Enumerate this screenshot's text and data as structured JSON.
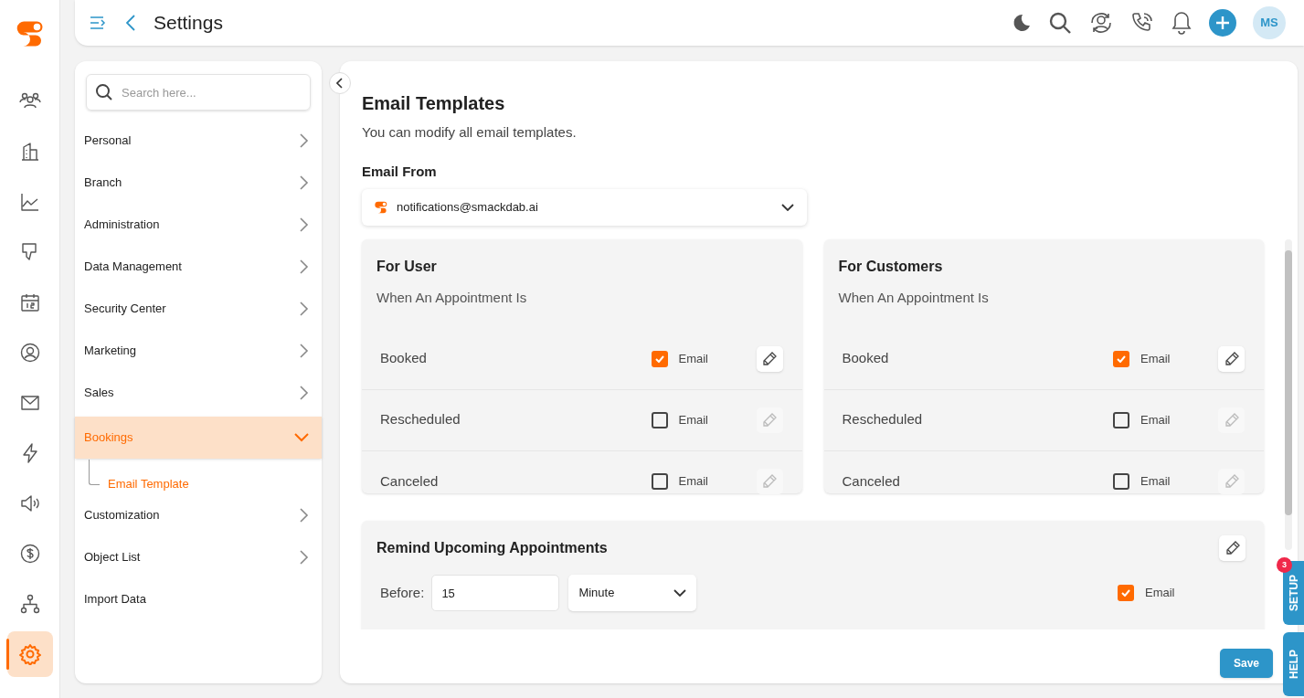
{
  "header": {
    "title": "Settings",
    "avatar": "MS"
  },
  "rail": [
    {
      "kind": "people",
      "selected": false
    },
    {
      "kind": "building",
      "selected": false
    },
    {
      "kind": "chart",
      "selected": false
    },
    {
      "kind": "thumbs-down",
      "selected": false
    },
    {
      "kind": "calendar",
      "selected": false
    },
    {
      "kind": "user",
      "selected": false
    },
    {
      "kind": "mail",
      "selected": false
    },
    {
      "kind": "bolt",
      "selected": false
    },
    {
      "kind": "speaker",
      "selected": false
    },
    {
      "kind": "dollar",
      "selected": false
    },
    {
      "kind": "hierarchy",
      "selected": false
    },
    {
      "kind": "gear",
      "selected": true
    }
  ],
  "settings_menu": {
    "search": {
      "placeholder": "Search here..."
    },
    "items": [
      {
        "label": "Personal",
        "kind": "group",
        "expanded": false
      },
      {
        "label": "Branch",
        "kind": "group",
        "expanded": false
      },
      {
        "label": "Administration",
        "kind": "group",
        "expanded": false
      },
      {
        "label": "Data Management",
        "kind": "group",
        "expanded": false
      },
      {
        "label": "Security Center",
        "kind": "group",
        "expanded": false
      },
      {
        "label": "Marketing",
        "kind": "group",
        "expanded": false
      },
      {
        "label": "Sales",
        "kind": "group",
        "expanded": false
      },
      {
        "label": "Bookings",
        "kind": "group",
        "expanded": true,
        "children": [
          {
            "label": "Email Template",
            "selected": true
          }
        ]
      },
      {
        "label": "Customization",
        "kind": "group",
        "expanded": false
      },
      {
        "label": "Object List",
        "kind": "group",
        "expanded": false
      },
      {
        "label": "Import Data",
        "kind": "link"
      }
    ]
  },
  "content": {
    "title": "Email Templates",
    "subtitle": "You can modify all email templates.",
    "email_from": {
      "label": "Email From",
      "value": "notifications@smackdab.ai"
    },
    "panels": [
      {
        "title": "For User",
        "subtitle": "When An Appointment Is",
        "rows": [
          {
            "label": "Booked",
            "checked": true,
            "option": "Email"
          },
          {
            "label": "Rescheduled",
            "checked": false,
            "option": "Email"
          },
          {
            "label": "Canceled",
            "checked": false,
            "option": "Email"
          }
        ]
      },
      {
        "title": "For Customers",
        "subtitle": "When An Appointment Is",
        "rows": [
          {
            "label": "Booked",
            "checked": true,
            "option": "Email"
          },
          {
            "label": "Rescheduled",
            "checked": false,
            "option": "Email"
          },
          {
            "label": "Canceled",
            "checked": false,
            "option": "Email"
          }
        ]
      }
    ],
    "reminder": {
      "title": "Remind Upcoming Appointments",
      "before_label": "Before:",
      "value": "15",
      "unit": "Minute",
      "checked": true,
      "option": "Email"
    },
    "save": "Save"
  },
  "side_tabs": [
    {
      "label": "SETUP",
      "badge": "3"
    },
    {
      "label": "HELP"
    }
  ]
}
